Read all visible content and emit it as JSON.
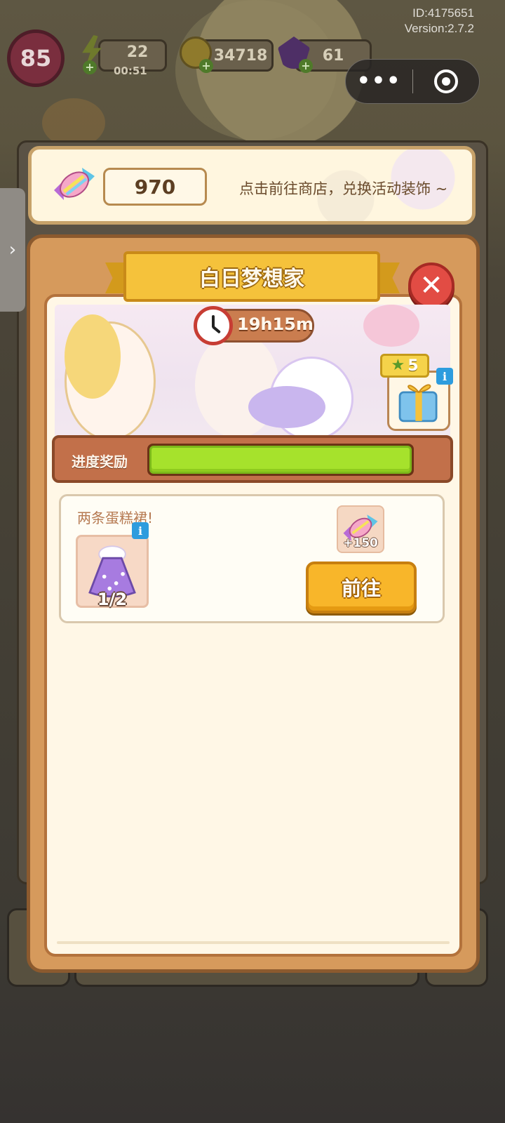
{
  "system": {
    "id_text": "ID:4175651",
    "version_text": "Version:2.7.2"
  },
  "hud": {
    "level": "85",
    "energy": "22",
    "energy_timer": "00:51",
    "coins": "34718",
    "gems": "61",
    "menu_dots": "•••"
  },
  "banner": {
    "candy_count": "970",
    "hint": "点击前往商店，兑换活动装饰 ~"
  },
  "dialog": {
    "title": "白日梦想家",
    "close_glyph": "✕",
    "timer": "19h15m",
    "gift_stars": "5",
    "progress_label": "进度奖励",
    "progress_fraction": 1.0,
    "task": {
      "title": "两条蛋糕裙!",
      "item_progress": "1/2",
      "reward_amount": "+150",
      "go_button": "前往"
    },
    "info_glyph": "i"
  },
  "colors": {
    "accent_yellow": "#f5c23b",
    "close_red": "#e24c44",
    "progress_green": "#a6e22c",
    "panel_brown": "#d69a5c"
  },
  "icons": [
    "energy-icon",
    "coin-icon",
    "gem-icon",
    "candy-icon",
    "clock-icon",
    "gift-icon",
    "star-icon",
    "dress-icon",
    "close-icon",
    "info-icon",
    "chevron-right-icon",
    "target-icon"
  ]
}
